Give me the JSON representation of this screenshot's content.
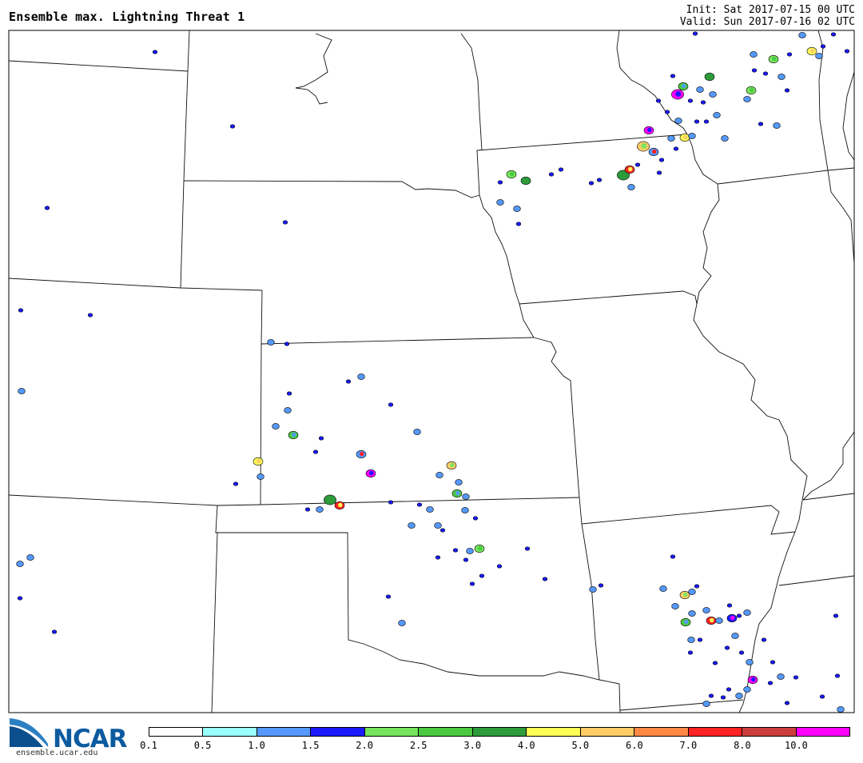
{
  "title": "Ensemble max. Lightning Threat 1",
  "init": "Init: Sat 2017-07-15 00 UTC",
  "valid": "Valid: Sun 2017-07-16 02 UTC",
  "logo": {
    "name": "NCAR",
    "url": "ensemble.ucar.edu"
  },
  "colorbar": {
    "colors": [
      "#ffffff",
      "#99ffff",
      "#5599ff",
      "#1a1aff",
      "#77e55d",
      "#4acb3f",
      "#2d9b3a",
      "#ffff55",
      "#ffcc66",
      "#ff8844",
      "#ff2222",
      "#cc3d3d",
      "#ff00ff"
    ],
    "labels": [
      "0.1",
      "0.5",
      "1.0",
      "1.5",
      "2.0",
      "2.5",
      "3.0",
      "4.0",
      "5.0",
      "6.0",
      "7.0",
      "8.0",
      "10.0"
    ]
  }
}
